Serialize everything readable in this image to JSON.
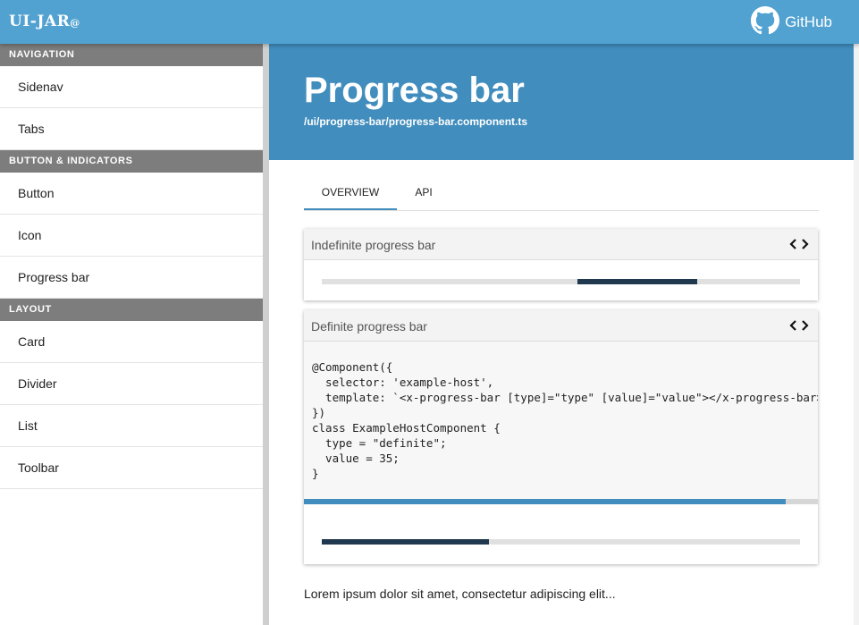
{
  "app": {
    "logo": "UI-JAR",
    "logo_suffix": "@",
    "github_label": "GitHub"
  },
  "sidebar": {
    "groups": [
      {
        "header": "NAVIGATION",
        "items": [
          "Sidenav",
          "Tabs"
        ]
      },
      {
        "header": "BUTTON & INDICATORS",
        "items": [
          "Button",
          "Icon",
          "Progress bar"
        ]
      },
      {
        "header": "LAYOUT",
        "items": [
          "Card",
          "Divider",
          "List",
          "Toolbar"
        ]
      }
    ]
  },
  "page": {
    "title": "Progress bar",
    "path": "/ui/progress-bar/progress-bar.component.ts",
    "tabs": [
      "OVERVIEW",
      "API"
    ],
    "active_tab": "OVERVIEW"
  },
  "examples": {
    "indefinite": {
      "title": "Indefinite progress bar"
    },
    "definite": {
      "title": "Definite progress bar",
      "code": "@Component({\n  selector: 'example-host',\n  template: `<x-progress-bar [type]=\"type\" [value]=\"value\"></x-progress-bar>`\n})\nclass ExampleHostComponent {\n  type = \"definite\";\n  value = 35;\n}",
      "value_percent": 35
    }
  },
  "body_text": "Lorem ipsum dolor sit amet, consectetur adipiscing elit...",
  "colors": {
    "toolbar": "#52a2d1",
    "hero": "#418dbd",
    "progress_fill": "#21394e",
    "group_header": "#7d7d7d"
  },
  "icons": {
    "github": "github-icon",
    "code_toggle": "code-icon"
  }
}
